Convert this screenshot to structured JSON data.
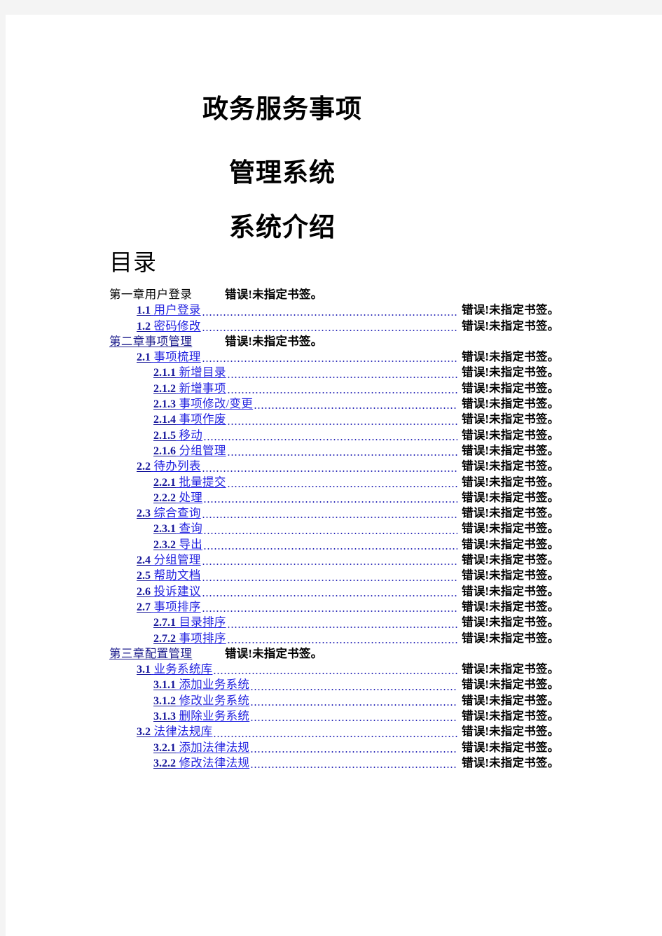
{
  "document": {
    "background_color": "#f4f4f4",
    "page_color": "#ffffff"
  },
  "cover": {
    "title_line_1": "政务服务事项",
    "title_line_2": "管理系统",
    "title_line_3": "系统介绍"
  },
  "toc": {
    "heading": "目录",
    "page_placeholder": "错误!未指定书签。",
    "colors": {
      "link_number": "#16169a",
      "link_title": "#2222e0",
      "chapter_link": "#1c1c8c",
      "leader_dots": "#2b2bb8",
      "page_ref": "#000000"
    },
    "entries": [
      {
        "level": 1,
        "linked": false,
        "text": "第一章用户登录",
        "number": "",
        "title": "",
        "page": "错误!未指定书签。"
      },
      {
        "level": 2,
        "linked": true,
        "text": "",
        "number": "1.1",
        "title": "用户登录",
        "page": "错误!未指定书签。"
      },
      {
        "level": 2,
        "linked": true,
        "text": "",
        "number": "1.2",
        "title": "密码修改",
        "page": "错误!未指定书签。"
      },
      {
        "level": 1,
        "linked": true,
        "text": "第二章事项管理",
        "number": "",
        "title": "",
        "page": "错误!未指定书签。"
      },
      {
        "level": 2,
        "linked": true,
        "text": "",
        "number": "2.1",
        "title": "事项梳理",
        "page": "错误!未指定书签。"
      },
      {
        "level": 3,
        "linked": true,
        "text": "",
        "number": "2.1.1",
        "title": "新增目录",
        "page": "错误!未指定书签。"
      },
      {
        "level": 3,
        "linked": true,
        "text": "",
        "number": "2.1.2",
        "title": "新增事项",
        "page": "错误!未指定书签。"
      },
      {
        "level": 3,
        "linked": true,
        "text": "",
        "number": "2.1.3",
        "title": "事项修改/变更 ",
        "page": "错误!未指定书签。"
      },
      {
        "level": 3,
        "linked": true,
        "text": "",
        "number": "2.1.4",
        "title": "事项作废",
        "page": "错误!未指定书签。"
      },
      {
        "level": 3,
        "linked": true,
        "text": "",
        "number": "2.1.5",
        "title": "移动",
        "page": "错误!未指定书签。"
      },
      {
        "level": 3,
        "linked": true,
        "text": "",
        "number": "2.1.6",
        "title": "分组管理",
        "page": "错误!未指定书签。"
      },
      {
        "level": 2,
        "linked": true,
        "text": "",
        "number": "2.2",
        "title": "待办列表",
        "page": "错误!未指定书签。"
      },
      {
        "level": 3,
        "linked": true,
        "text": "",
        "number": "2.2.1",
        "title": "批量提交",
        "page": "错误!未指定书签。"
      },
      {
        "level": 3,
        "linked": true,
        "text": "",
        "number": "2.2.2",
        "title": "处理",
        "page": "错误!未指定书签。"
      },
      {
        "level": 2,
        "linked": true,
        "text": "",
        "number": "2.3",
        "title": "综合查询",
        "page": "错误!未指定书签。"
      },
      {
        "level": 3,
        "linked": true,
        "text": "",
        "number": "2.3.1",
        "title": "查询",
        "page": "错误!未指定书签。"
      },
      {
        "level": 3,
        "linked": true,
        "text": "",
        "number": "2.3.2",
        "title": "导出",
        "page": "错误!未指定书签。"
      },
      {
        "level": 2,
        "linked": true,
        "text": "",
        "number": "2.4",
        "title": "分组管理",
        "page": "错误!未指定书签。"
      },
      {
        "level": 2,
        "linked": true,
        "text": "",
        "number": "2.5",
        "title": "帮助文档",
        "page": "错误!未指定书签。"
      },
      {
        "level": 2,
        "linked": true,
        "text": "",
        "number": "2.6",
        "title": "投诉建议",
        "page": "错误!未指定书签。"
      },
      {
        "level": 2,
        "linked": true,
        "text": "",
        "number": "2.7",
        "title": "事项排序",
        "page": "错误!未指定书签。"
      },
      {
        "level": 3,
        "linked": true,
        "text": "",
        "number": "2.7.1",
        "title": "目录排序",
        "page": "错误!未指定书签。"
      },
      {
        "level": 3,
        "linked": true,
        "text": "",
        "number": "2.7.2",
        "title": "事项排序",
        "page": "错误!未指定书签。"
      },
      {
        "level": 1,
        "linked": true,
        "text": "第三章配置管理",
        "number": "",
        "title": "",
        "page": "错误!未指定书签。"
      },
      {
        "level": 2,
        "linked": true,
        "text": "",
        "number": "3.1",
        "title": "业务系统库",
        "page": "错误!未指定书签。"
      },
      {
        "level": 3,
        "linked": true,
        "text": "",
        "number": "3.1.1",
        "title": "添加业务系统",
        "page": "错误!未指定书签。"
      },
      {
        "level": 3,
        "linked": true,
        "text": "",
        "number": "3.1.2",
        "title": "修改业务系统",
        "page": "错误!未指定书签。"
      },
      {
        "level": 3,
        "linked": true,
        "text": "",
        "number": "3.1.3",
        "title": "删除业务系统",
        "page": "错误!未指定书签。"
      },
      {
        "level": 2,
        "linked": true,
        "text": "",
        "number": "3.2",
        "title": "法律法规库",
        "page": "错误!未指定书签。"
      },
      {
        "level": 3,
        "linked": true,
        "text": "",
        "number": "3.2.1",
        "title": "添加法律法规",
        "page": "错误!未指定书签。"
      },
      {
        "level": 3,
        "linked": true,
        "text": "",
        "number": "3.2.2",
        "title": "修改法律法规",
        "page": "错误!未指定书签。"
      }
    ]
  }
}
